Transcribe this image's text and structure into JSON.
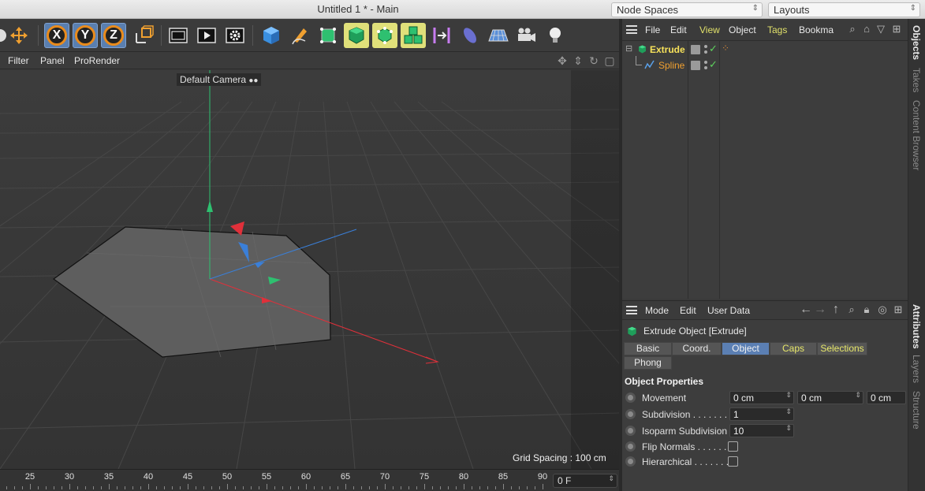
{
  "window": {
    "title": "Untitled 1 * - Main",
    "node_spaces": "Node Spaces",
    "layouts": "Layouts"
  },
  "toolbar": {
    "tools": [
      "partial-tool-icon",
      "move-icon",
      "x-axis-lock-icon",
      "y-axis-lock-icon",
      "z-axis-lock-icon",
      "coordinate-system-icon",
      "render-region-icon",
      "render-view-icon",
      "render-settings-icon",
      "cube-icon",
      "pen-icon",
      "subdivision-icon",
      "extrude-generator-icon",
      "cloner-icon",
      "mograph-icon",
      "deformer-icon",
      "floor-icon",
      "grid-icon",
      "camera-icon",
      "light-icon"
    ],
    "axis_labels": [
      "X",
      "Y",
      "Z"
    ]
  },
  "viewport": {
    "menu": [
      "Filter",
      "Panel",
      "ProRender"
    ],
    "camera": "Default Camera",
    "grid_spacing": "Grid Spacing : 100 cm"
  },
  "timeline": {
    "ticks": [
      "25",
      "30",
      "35",
      "40",
      "45",
      "50",
      "55",
      "60",
      "65",
      "70",
      "75",
      "80",
      "85",
      "90"
    ],
    "frame": "0 F"
  },
  "objects": {
    "menu": [
      "File",
      "Edit",
      "View",
      "Object",
      "Tags",
      "Bookma"
    ],
    "items": [
      {
        "name": "Extrude",
        "selected": true
      },
      {
        "name": "Spline",
        "selected": false
      }
    ]
  },
  "attributes": {
    "menu": [
      "Mode",
      "Edit",
      "User Data"
    ],
    "title": "Extrude Object [Extrude]",
    "tabs": [
      "Basic",
      "Coord.",
      "Object",
      "Caps",
      "Selections",
      "Phong"
    ],
    "active_tab": "Object",
    "section": "Object Properties",
    "movement_label": "Movement",
    "movement": [
      "0 cm",
      "0 cm",
      "0 cm"
    ],
    "subdivision_label": "Subdivision . . . . . . .",
    "subdivision": "1",
    "isoparm_label": "Isoparm Subdivision",
    "isoparm": "10",
    "flip_label": "Flip Normals . . . . . .",
    "hier_label": "Hierarchical . . . . . . ."
  },
  "side_tabs": {
    "top": [
      "Objects",
      "Takes",
      "Content Browser"
    ],
    "bottom": [
      "Attributes",
      "Layers",
      "Structure"
    ]
  },
  "colors": {
    "accent_blue": "#5b7fb3",
    "selected_yellow": "#f7e25a",
    "axis_x": "#e0303a",
    "axis_y": "#2ec070",
    "axis_z": "#3a7fd8"
  }
}
